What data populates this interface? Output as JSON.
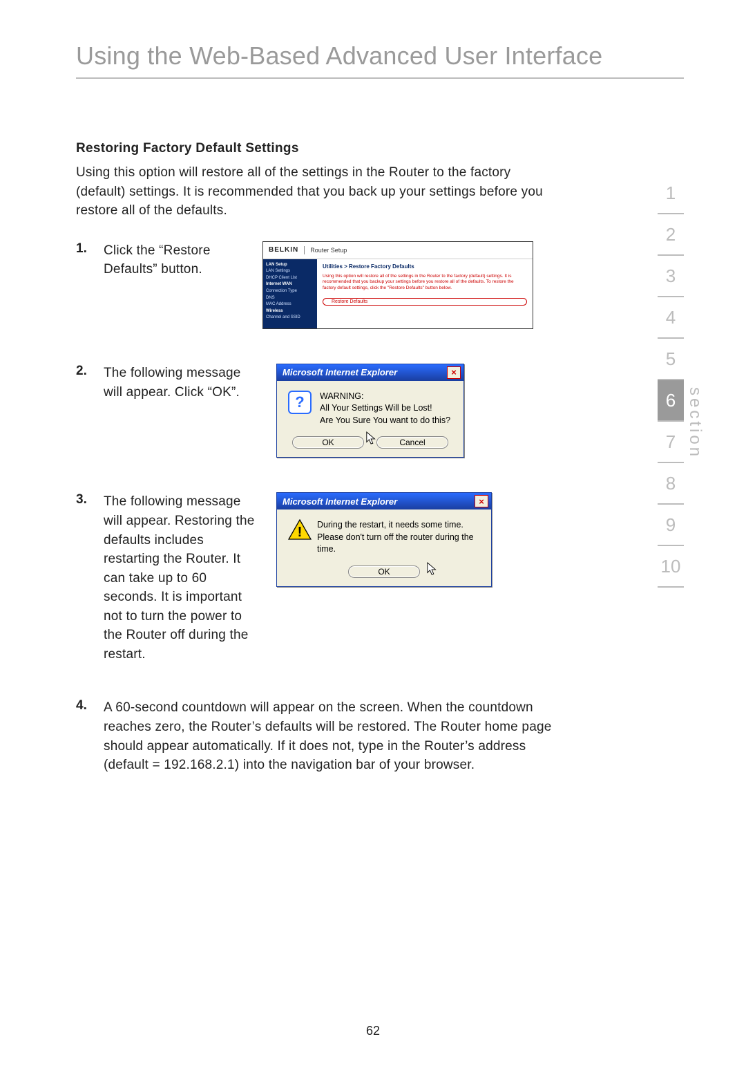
{
  "title": "Using the Web-Based Advanced User Interface",
  "subheading": "Restoring Factory Default Settings",
  "intro": "Using this option will restore all of the settings in the Router to the factory (default) settings. It is recommended that you back up your settings before you restore all of the defaults.",
  "steps": {
    "s1": {
      "num": "1.",
      "text": "Click the “Restore Defaults” button."
    },
    "s2": {
      "num": "2.",
      "text": "The following message will appear. Click “OK”."
    },
    "s3": {
      "num": "3.",
      "text": "The following message will appear. Restoring the defaults includes restarting the Router. It can take up to 60 seconds. It is important not to turn the power to the Router off during the restart."
    },
    "s4": {
      "num": "4.",
      "text": "A 60-second countdown will appear on the screen. When the countdown reaches zero, the Router’s defaults will be restored. The Router home page should appear automatically. If it does not, type in the Router’s address (default = 192.168.2.1) into the navigation bar of your browser."
    }
  },
  "shot1": {
    "brand": "BELKIN",
    "router_setup": "Router Setup",
    "nav": {
      "lan_setup": "LAN Setup",
      "lan_settings": "LAN Settings",
      "dhcp": "DHCP Client List",
      "internet_wan": "Internet WAN",
      "conn_type": "Connection Type",
      "dns": "DNS",
      "mac": "MAC Address",
      "wireless": "Wireless",
      "chan": "Channel and SSID"
    },
    "breadcrumb": "Utilities > Restore Factory Defaults",
    "desc": "Using this option will restore all of the settings in the Router to the factory (default) settings. It is recommended that you backup your settings before you restore all of the defaults. To restore the factory default settings, click the \"Restore Defaults\" button below.",
    "button": "Restore Defaults"
  },
  "dialog": {
    "title": "Microsoft Internet Explorer",
    "ok": "OK",
    "cancel": "Cancel"
  },
  "shot2": {
    "line1": "WARNING:",
    "line2": "All Your Settings Will be Lost!",
    "line3": "Are You Sure You want to do this?"
  },
  "shot3": {
    "line1": "During the restart, it needs some time.",
    "line2": "Please don't turn off the router during the time."
  },
  "tabs": [
    "1",
    "2",
    "3",
    "4",
    "5",
    "6",
    "7",
    "8",
    "9",
    "10"
  ],
  "active_tab": "6",
  "section_label": "section",
  "page_number": "62"
}
